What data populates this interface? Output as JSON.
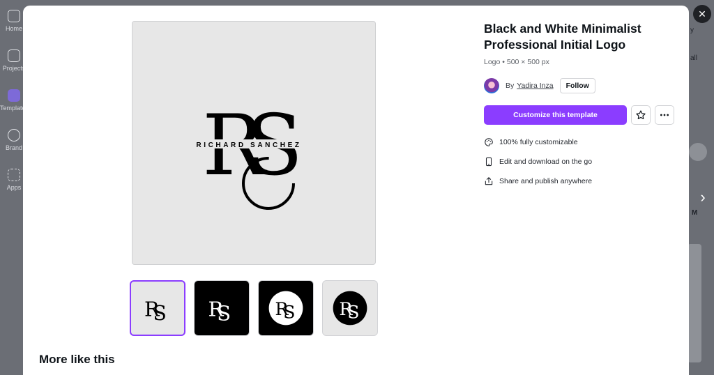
{
  "background": {
    "sidebar": [
      {
        "label": "Home",
        "icon": "home-icon"
      },
      {
        "label": "Projects",
        "icon": "folder-icon"
      },
      {
        "label": "Templates",
        "icon": "templates-icon"
      },
      {
        "label": "Brand",
        "icon": "brand-icon"
      },
      {
        "label": "Apps",
        "icon": "apps-icon"
      }
    ],
    "right_text_1": "y",
    "right_text_2": "all",
    "right_text_3": "M"
  },
  "modal": {
    "title": "Black and White Minimalist Professional Initial Logo",
    "meta": "Logo • 500 × 500 px",
    "author_prefix": "By",
    "author_name": "Yadira Inza",
    "follow_label": "Follow",
    "customize_label": "Customize this template",
    "features": [
      {
        "icon": "palette-icon",
        "text": "100% fully customizable"
      },
      {
        "icon": "phone-icon",
        "text": "Edit and download on the go"
      },
      {
        "icon": "share-icon",
        "text": "Share and publish anywhere"
      }
    ],
    "more_like_this": "More like this",
    "logo": {
      "monogram": "RS",
      "name": "RICHARD SANCHEZ"
    },
    "thumbnails": [
      {
        "style": "grey",
        "selected": true
      },
      {
        "style": "black",
        "selected": false
      },
      {
        "style": "black-circle",
        "selected": false
      },
      {
        "style": "grey-circle",
        "selected": false
      }
    ]
  },
  "colors": {
    "accent": "#8b3dff",
    "text": "#0e1318",
    "overlay": "#6b6e75"
  },
  "icons": {
    "close": "close-icon",
    "star": "star-icon",
    "more": "more-icon",
    "next": "chevron-right-icon"
  }
}
